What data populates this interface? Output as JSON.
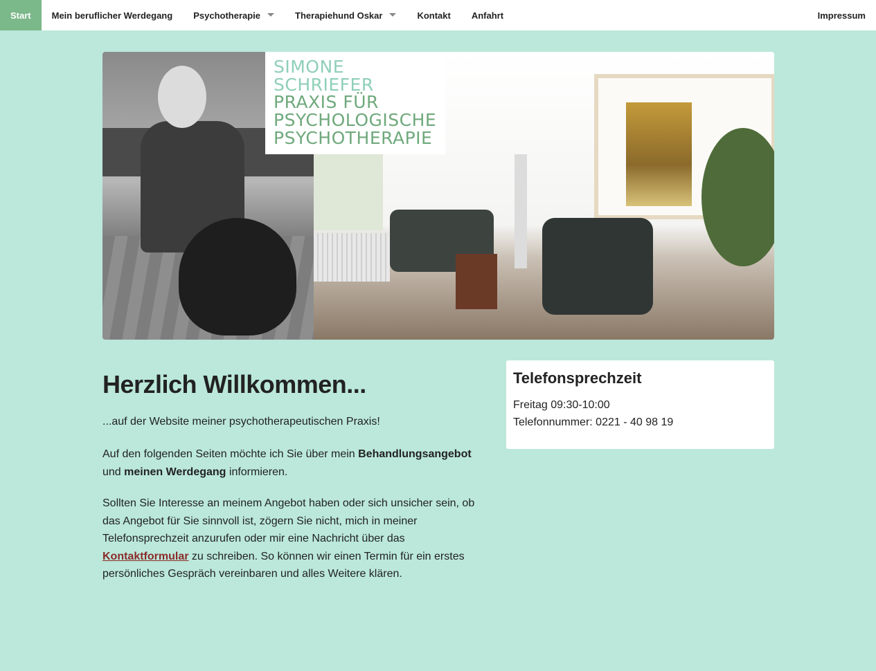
{
  "nav": {
    "items": [
      {
        "label": "Start"
      },
      {
        "label": "Mein beruflicher Werdegang"
      },
      {
        "label": "Psychotherapie"
      },
      {
        "label": "Therapiehund Oskar"
      },
      {
        "label": "Kontakt"
      },
      {
        "label": "Anfahrt"
      }
    ],
    "right_label": "Impressum"
  },
  "hero": {
    "logo_lines": [
      {
        "text": "SIMONE",
        "color": "#8fcfb8"
      },
      {
        "text": "SCHRIEFER",
        "color": "#8fcfb8"
      },
      {
        "text": "PRAXIS FÜR",
        "color": "#6fa97c"
      },
      {
        "text": "PSYCHOLOGISCHE",
        "color": "#6fa97c"
      },
      {
        "text": "PSYCHOTHERAPIE",
        "color": "#6fa97c"
      }
    ]
  },
  "main": {
    "heading": "Herzlich Willkommen...",
    "intro": "...auf der Website meiner psychotherapeutischen Praxis!",
    "para2": {
      "t1": "Auf den folgenden Seiten möchte ich Sie über mein ",
      "b1": "Behandlungsangebot",
      "t2": " und ",
      "b2": "meinen Werdegang",
      "t3": " informieren."
    },
    "para3": {
      "t1": "Sollten Sie Interesse an meinem Angebot haben oder sich unsicher sein, ob das Angebot für Sie sinnvoll ist, zögern Sie nicht, mich in meiner Telefonsprechzeit anzurufen oder mir eine Nachricht über das ",
      "link": "Kontaktformular",
      "t2": " zu schreiben. So können wir einen Termin für ein erstes persönliches Gespräch vereinbaren und alles Weitere klären."
    }
  },
  "sidebar": {
    "title": "Telefonsprechzeit",
    "line1": "Freitag 09:30-10:00",
    "line2": "Telefonnummer: 0221 - 40 98 19"
  },
  "colors": {
    "page_bg": "#bbe8da",
    "nav_active": "#7bb88a",
    "link": "#8b2a2a"
  }
}
